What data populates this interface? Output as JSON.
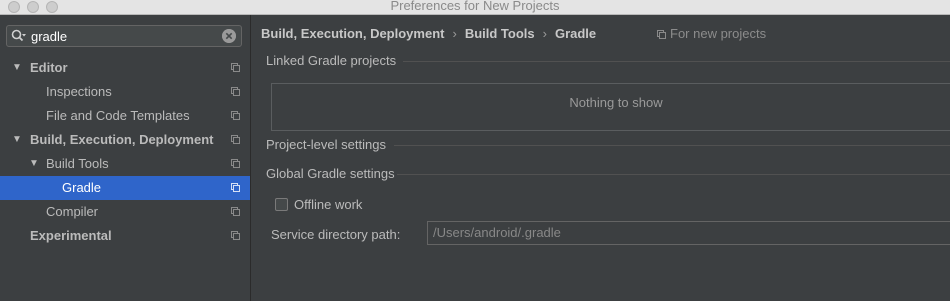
{
  "window": {
    "title": "Preferences for New Projects"
  },
  "search": {
    "value": "gradle"
  },
  "sidebar": {
    "items": [
      {
        "label": "Editor",
        "expanded": true
      },
      {
        "label": "Inspections"
      },
      {
        "label": "File and Code Templates"
      },
      {
        "label": "Build, Execution, Deployment",
        "expanded": true
      },
      {
        "label": "Build Tools",
        "expanded": true
      },
      {
        "label": "Gradle",
        "selected": true
      },
      {
        "label": "Compiler"
      },
      {
        "label": "Experimental"
      }
    ]
  },
  "breadcrumb": {
    "items": [
      "Build, Execution, Deployment",
      "Build Tools",
      "Gradle"
    ],
    "separator": "›"
  },
  "scope": {
    "label": "For new projects"
  },
  "main": {
    "linked_title": "Linked Gradle projects",
    "empty_text": "Nothing to show",
    "project_level_title": "Project-level settings",
    "global_title": "Global Gradle settings",
    "offline_label": "Offline work",
    "offline_checked": false,
    "service_dir_label": "Service directory path:",
    "service_dir_value": "/Users/android/.gradle"
  },
  "colors": {
    "background": "#3c3f41",
    "selection": "#2f65ca",
    "text": "#bbbbbb"
  }
}
